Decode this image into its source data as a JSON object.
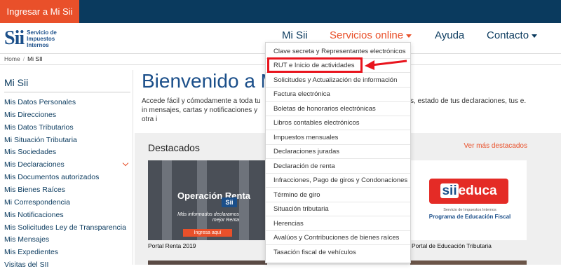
{
  "topbar": {
    "login_label": "Ingresar a Mi Sii"
  },
  "logo": {
    "mark": "Sii",
    "text": "Servicio de Impuestos Internos"
  },
  "nav": {
    "items": [
      {
        "label": "Mi Sii"
      },
      {
        "label": "Servicios online"
      },
      {
        "label": "Ayuda"
      },
      {
        "label": "Contacto"
      }
    ]
  },
  "breadcrumb": {
    "home": "Home",
    "separator": "/",
    "current": "Mi SII"
  },
  "sidebar": {
    "title": "Mi Sii",
    "items": [
      "Mis Datos Personales",
      "Mis Direcciones",
      "Mis Datos Tributarios",
      "Mi Situación Tributaria",
      "Mis Sociedades",
      "Mis Declaraciones",
      "Mis Documentos autorizados",
      "Mis Bienes Raíces",
      "Mi Correspondencia",
      "Mis Notificaciones",
      "Mis Solicitudes Ley de Transparencia",
      "Mis Mensajes",
      "Mis Expedientes",
      "Visitas del SII"
    ]
  },
  "main": {
    "title": "Bienvenido a M",
    "intro_left": "Accede fácil y cómodamente a toda tu in mensajes, cartas y notificaciones y otra i",
    "intro_right": "s, estado de tus declaraciones, tus e."
  },
  "featured": {
    "title": "Destacados",
    "see_more": "Ver más destacados",
    "cards": [
      {
        "caption": "Portal Renta 2019",
        "banner_title": "Operación Renta",
        "banner_badge": "Sii",
        "banner_sub": "Más informados declaramos mejor Renta",
        "banner_cta": "Ingresa aquí"
      },
      {
        "caption": "Portal de Educación Tributaria",
        "logo_sii": "sii",
        "logo_word": "educa",
        "logo_sub": "Servicio de Impuestos Internos",
        "logo_program": "Programa de Educación Fiscal"
      }
    ]
  },
  "services_menu": {
    "items": [
      "Clave secreta y Representantes electrónicos",
      "RUT e Inicio de actividades",
      "Solicitudes y Actualización de información",
      "Factura electrónica",
      "Boletas de honorarios electrónicas",
      "Libros contables electrónicos",
      "Impuestos mensuales",
      "Declaraciones juradas",
      "Declaración de renta",
      "Infracciones, Pago de giros y Condonaciones",
      "Término de giro",
      "Situación tributaria",
      "Herencias",
      "Avalúos y Contribuciones de bienes raíces",
      "Tasación fiscal de vehículos"
    ]
  },
  "colors": {
    "navy": "#0a3a5e",
    "orange": "#e9502a",
    "highlight": "#e8141d",
    "brand_blue": "#1b4f8a"
  }
}
